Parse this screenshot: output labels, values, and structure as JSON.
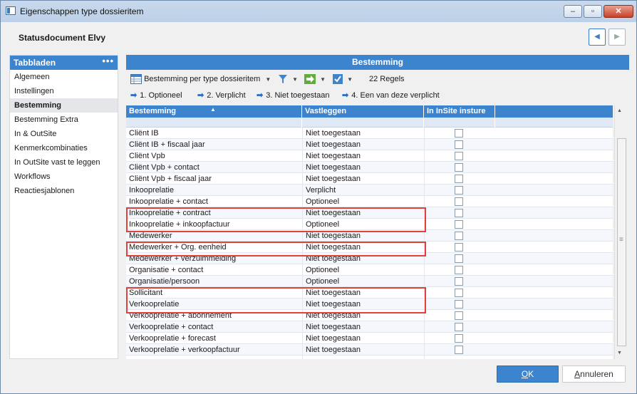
{
  "window": {
    "title": "Eigenschappen type dossieritem",
    "controls": [
      "minimize",
      "maximize",
      "close"
    ]
  },
  "header": {
    "title": "Statusdocument Elvy"
  },
  "sidebar": {
    "heading": "Tabbladen",
    "menu_glyph": "•••",
    "items": [
      {
        "label": "Algemeen"
      },
      {
        "label": "Instellingen"
      },
      {
        "label": "Bestemming",
        "active": true
      },
      {
        "label": "Bestemming Extra"
      },
      {
        "label": "In & OutSite"
      },
      {
        "label": "Kenmerkcombinaties"
      },
      {
        "label": "In OutSite vast te leggen"
      },
      {
        "label": "Workflows"
      },
      {
        "label": "Reactiesjablonen"
      }
    ]
  },
  "main": {
    "heading": "Bestemming",
    "toolbar": {
      "view_label": "Bestemming per type dossieritem",
      "count_label": "22 Regels"
    },
    "filters": [
      "1. Optioneel",
      "2. Verplicht",
      "3. Niet toegestaan",
      "4. Een van deze verplicht"
    ],
    "grid": {
      "columns": [
        "Bestemming",
        "Vastleggen",
        "In InSite insture"
      ],
      "rows": [
        {
          "bestemming": "Cliënt IB",
          "vastleggen": "Niet toegestaan"
        },
        {
          "bestemming": "Cliënt IB + fiscaal jaar",
          "vastleggen": "Niet toegestaan"
        },
        {
          "bestemming": "Cliënt Vpb",
          "vastleggen": "Niet toegestaan"
        },
        {
          "bestemming": "Cliënt Vpb + contact",
          "vastleggen": "Niet toegestaan"
        },
        {
          "bestemming": "Cliënt Vpb + fiscaal jaar",
          "vastleggen": "Niet toegestaan"
        },
        {
          "bestemming": "Inkooprelatie",
          "vastleggen": "Verplicht"
        },
        {
          "bestemming": "Inkooprelatie + contact",
          "vastleggen": "Optioneel"
        },
        {
          "bestemming": "Inkooprelatie + contract",
          "vastleggen": "Niet toegestaan"
        },
        {
          "bestemming": "Inkooprelatie + inkoopfactuur",
          "vastleggen": "Optioneel"
        },
        {
          "bestemming": "Medewerker",
          "vastleggen": "Niet toegestaan"
        },
        {
          "bestemming": "Medewerker + Org. eenheid",
          "vastleggen": "Niet toegestaan"
        },
        {
          "bestemming": "Medewerker + verzuimmelding",
          "vastleggen": "Niet toegestaan"
        },
        {
          "bestemming": "Organisatie + contact",
          "vastleggen": "Optioneel"
        },
        {
          "bestemming": "Organisatie/persoon",
          "vastleggen": "Optioneel"
        },
        {
          "bestemming": "Sollicitant",
          "vastleggen": "Niet toegestaan"
        },
        {
          "bestemming": "Verkooprelatie",
          "vastleggen": "Niet toegestaan"
        },
        {
          "bestemming": "Verkooprelatie + abonnement",
          "vastleggen": "Niet toegestaan"
        },
        {
          "bestemming": "Verkooprelatie + contact",
          "vastleggen": "Niet toegestaan"
        },
        {
          "bestemming": "Verkooprelatie + forecast",
          "vastleggen": "Niet toegestaan"
        },
        {
          "bestemming": "Verkooprelatie + verkoopfactuur",
          "vastleggen": "Niet toegestaan"
        }
      ]
    }
  },
  "footer": {
    "ok_label": "OK",
    "cancel_label": "Annuleren"
  },
  "colors": {
    "accent": "#3d84cf",
    "highlight": "#e2413b"
  }
}
